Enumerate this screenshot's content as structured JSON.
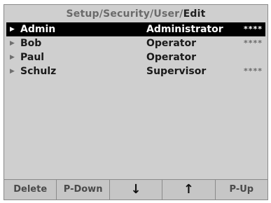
{
  "breadcrumb": {
    "path": [
      "Setup",
      "Security",
      "User"
    ],
    "separator": "/",
    "current": "Edit"
  },
  "users": [
    {
      "name": "Admin",
      "role": "Administrator",
      "password_mask": "****",
      "selected": true
    },
    {
      "name": "Bob",
      "role": "Operator",
      "password_mask": "****",
      "selected": false
    },
    {
      "name": "Paul",
      "role": "Operator",
      "password_mask": "",
      "selected": false
    },
    {
      "name": "Schulz",
      "role": "Supervisor",
      "password_mask": "****",
      "selected": false
    }
  ],
  "softkeys": [
    {
      "label": "Delete",
      "icon": ""
    },
    {
      "label": "P-Down",
      "icon": ""
    },
    {
      "label": "↓",
      "icon": "down-arrow-icon"
    },
    {
      "label": "↑",
      "icon": "up-arrow-icon"
    },
    {
      "label": "P-Up",
      "icon": ""
    }
  ],
  "colors": {
    "background": "#cfcfcf",
    "selection": "#000000",
    "text": "#1a1a1a",
    "muted": "#6a6a6a"
  }
}
